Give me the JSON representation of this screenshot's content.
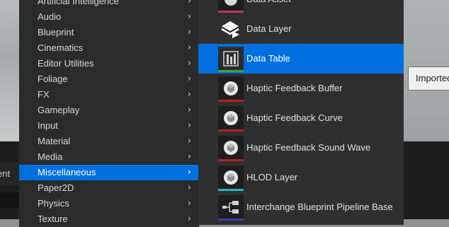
{
  "background": {
    "left_tab_text": "ent",
    "tooltip_text": "Imported"
  },
  "category_menu": {
    "items": [
      {
        "label": "Artificial Intelligence",
        "active": false
      },
      {
        "label": "Audio",
        "active": false
      },
      {
        "label": "Blueprint",
        "active": false
      },
      {
        "label": "Cinematics",
        "active": false
      },
      {
        "label": "Editor Utilities",
        "active": false
      },
      {
        "label": "Foliage",
        "active": false
      },
      {
        "label": "FX",
        "active": false
      },
      {
        "label": "Gameplay",
        "active": false
      },
      {
        "label": "Input",
        "active": false
      },
      {
        "label": "Material",
        "active": false
      },
      {
        "label": "Media",
        "active": false
      },
      {
        "label": "Miscellaneous",
        "active": true
      },
      {
        "label": "Paper2D",
        "active": false
      },
      {
        "label": "Physics",
        "active": false
      },
      {
        "label": "Texture",
        "active": false
      }
    ],
    "chevron_glyph": "›"
  },
  "asset_menu": {
    "items": [
      {
        "label": "Data Asset",
        "icon": "data-asset-icon",
        "stripe": "#c2336b",
        "active": false
      },
      {
        "label": "Data Layer",
        "icon": "data-layer-icon",
        "stripe": "#2f2f2f",
        "active": false
      },
      {
        "label": "Data Table",
        "icon": "data-table-icon",
        "stripe": "#3fa33f",
        "active": true
      },
      {
        "label": "Haptic Feedback Buffer",
        "icon": "cube-icon",
        "stripe": "#b32020",
        "active": false
      },
      {
        "label": "Haptic Feedback Curve",
        "icon": "cube-icon",
        "stripe": "#b32020",
        "active": false
      },
      {
        "label": "Haptic Feedback Sound Wave",
        "icon": "cube-icon",
        "stripe": "#b32020",
        "active": false
      },
      {
        "label": "HLOD Layer",
        "icon": "cube-icon",
        "stripe": "#20b8c0",
        "active": false
      },
      {
        "label": "Interchange Blueprint Pipeline Base",
        "icon": "pipeline-icon",
        "stripe": "#3a3fb0",
        "active": false
      }
    ]
  },
  "colors": {
    "accent": "#0070e0",
    "menu_bg": "#2b2b2b",
    "submenu_bg": "#2f2f2f"
  }
}
